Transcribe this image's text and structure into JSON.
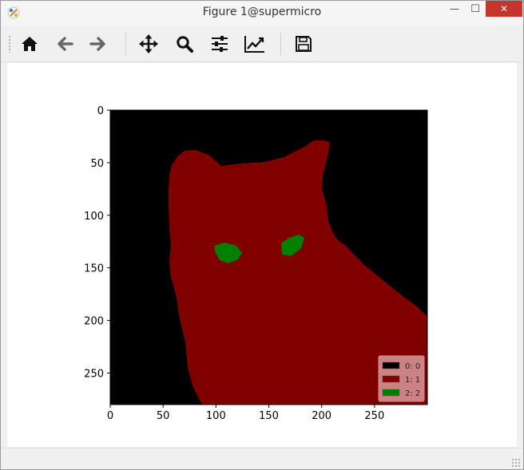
{
  "window": {
    "title": "Figure 1@supermicro",
    "minimize_glyph": "—",
    "maximize_glyph": "☐",
    "close_glyph": "✕"
  },
  "toolbar": {
    "tools": [
      "home-icon",
      "back-arrow-icon",
      "forward-arrow-icon",
      "pan-icon",
      "zoom-icon",
      "subplots-icon",
      "edit-axes-icon",
      "save-icon"
    ]
  },
  "figure": {
    "image": "segmentation mask of a cat face",
    "colors": {
      "class0": "#000000",
      "class1": "#800000",
      "class2": "#008000"
    }
  },
  "chart_data": {
    "type": "heatmap",
    "x_ticks": [
      "0",
      "50",
      "100",
      "150",
      "200",
      "250"
    ],
    "y_ticks": [
      "0",
      "50",
      "100",
      "150",
      "200",
      "250"
    ],
    "xlim": [
      0,
      300
    ],
    "ylim": [
      280,
      0
    ],
    "legend": {
      "placement": "bottom-right",
      "entries": [
        {
          "label": "0: 0",
          "color": "#000000"
        },
        {
          "label": "1: 1",
          "color": "#800000"
        },
        {
          "label": "2: 2",
          "color": "#008000"
        }
      ]
    }
  }
}
